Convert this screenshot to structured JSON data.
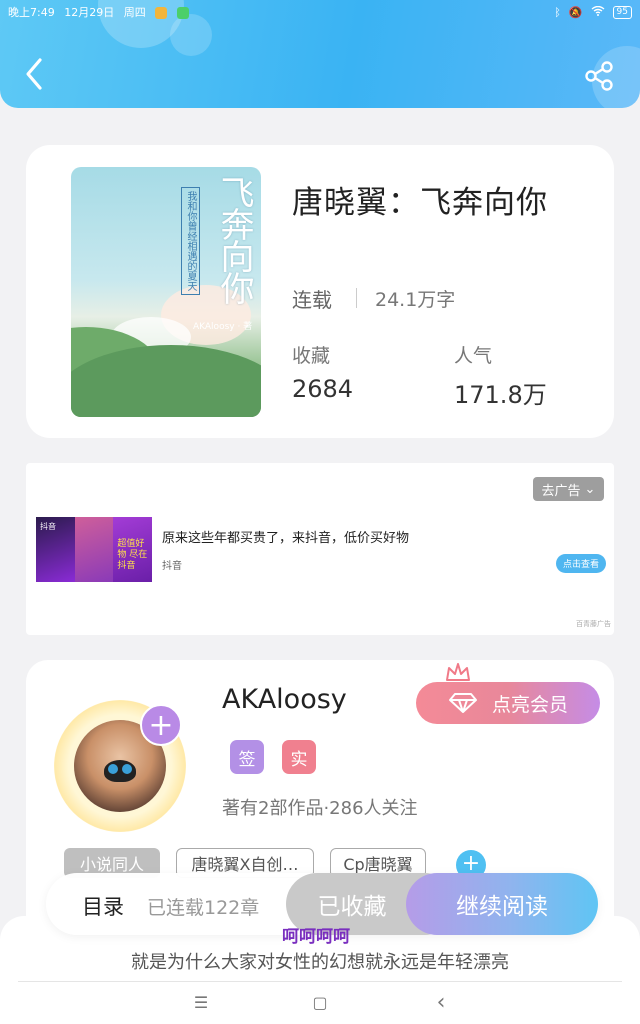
{
  "status_bar": {
    "time": "晚上7:49",
    "date": "12月29日",
    "weekday": "周四",
    "battery": "95"
  },
  "header": {
    "back_icon": "chevron-left-icon",
    "share_icon": "share-icon"
  },
  "book": {
    "title": "唐晓翼：飞奔向你",
    "cover_title": "飞奔向你",
    "cover_subtitle": "我和你曾经相遇的夏天",
    "cover_author": "AKAloosy · 著",
    "status": "连载",
    "word_count": "24.1万字",
    "favorites_label": "收藏",
    "favorites_value": "2684",
    "popularity_label": "人气",
    "popularity_value": "171.8万"
  },
  "ad": {
    "remove_label": "去广告",
    "text": "原来这些年都买贵了，来抖音，低价买好物",
    "source": "抖音",
    "cta_label": "点击查看",
    "thumb_text": "超值好物 尽在抖音",
    "thumb_brand": "抖音",
    "mark": "百青藤广告"
  },
  "author": {
    "name": "AKAloosy",
    "vip_label": "点亮会员",
    "badge_sign": "签",
    "badge_real": "实",
    "stats": "著有2部作品·286人关注",
    "tags": [
      "小说同人",
      "唐晓翼X自创…",
      "Cp唐晓翼"
    ]
  },
  "action_bar": {
    "toc_label": "目录",
    "toc_count": "已连载122章",
    "collected_label": "已收藏",
    "read_label": "继续阅读"
  },
  "overlay_text": "呵呵呵呵",
  "caption": "就是为什么大家对女性的幻想就永远是年轻漂亮",
  "nav": {
    "menu_glyph": "☰",
    "home_glyph": "▢",
    "back_glyph": "‹"
  },
  "colors": {
    "header_blue": "#3ab3f3",
    "vip_pink": "#f48a97",
    "badge_purple": "#b390e6",
    "badge_red": "#f0808f"
  }
}
